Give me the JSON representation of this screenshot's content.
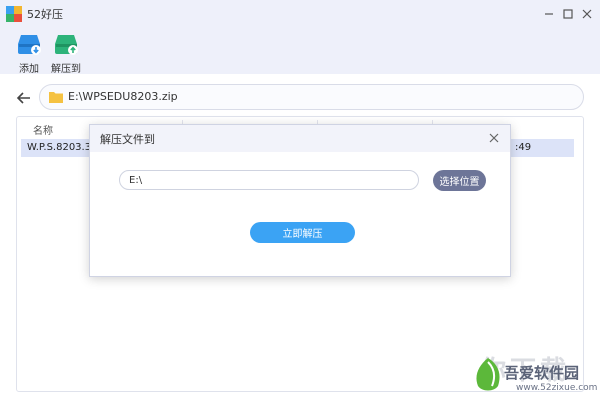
{
  "window": {
    "title": "52好压",
    "controls": [
      "minimize",
      "maximize",
      "close"
    ]
  },
  "toolbar": {
    "add_label": "添加",
    "extract_to_label": "解压到"
  },
  "pathbar": {
    "path": "E:\\WPSEDU8203.zip"
  },
  "file_table": {
    "columns": [
      "名称",
      "",
      "",
      ""
    ],
    "rows": [
      {
        "name": "W.P.S.8203.30.",
        "modified_tail": ":49"
      }
    ]
  },
  "dialog": {
    "title": "解压文件到",
    "destination_value": "E:\\",
    "choose_location_label": "选择位置",
    "extract_now_label": "立即解压"
  },
  "watermark": {
    "big_text": "你下载",
    "text": "吾爱软件园",
    "url": "www.52zixue.com"
  },
  "colors": {
    "window_bg": "#eef0fa",
    "accent_blue": "#3ba3f4",
    "choose_button": "#6d7598",
    "selected_row": "#dce3f8",
    "add_icon_blue": "#2f8fe6",
    "extract_icon_green": "#2db37a"
  },
  "icons": {
    "app": "app-logo-icon",
    "add": "add-archive-icon",
    "extract": "extract-to-icon",
    "back": "back-arrow-icon",
    "folder": "folder-icon",
    "close": "close-icon"
  }
}
